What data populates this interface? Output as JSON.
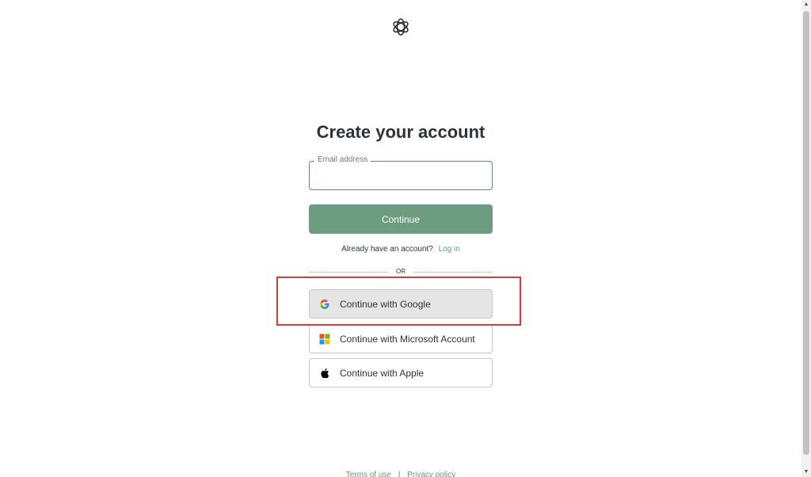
{
  "logo": {
    "icon": "openai-logo-icon"
  },
  "page": {
    "title": "Create your account"
  },
  "email": {
    "label": "Email address",
    "value": "",
    "placeholder": ""
  },
  "continue_label": "Continue",
  "login": {
    "prompt": "Already have an account?",
    "link": "Log in"
  },
  "divider_text": "OR",
  "social": [
    {
      "label": "Continue with Google",
      "icon": "google-icon"
    },
    {
      "label": "Continue with Microsoft Account",
      "icon": "microsoft-icon"
    },
    {
      "label": "Continue with Apple",
      "icon": "apple-icon"
    }
  ],
  "footer": {
    "terms": "Terms of use",
    "separator": "|",
    "privacy": "Privacy policy"
  },
  "colors": {
    "accent": "#10a37f",
    "continue_button": "#6c9d80",
    "highlight": "#d9393a"
  }
}
